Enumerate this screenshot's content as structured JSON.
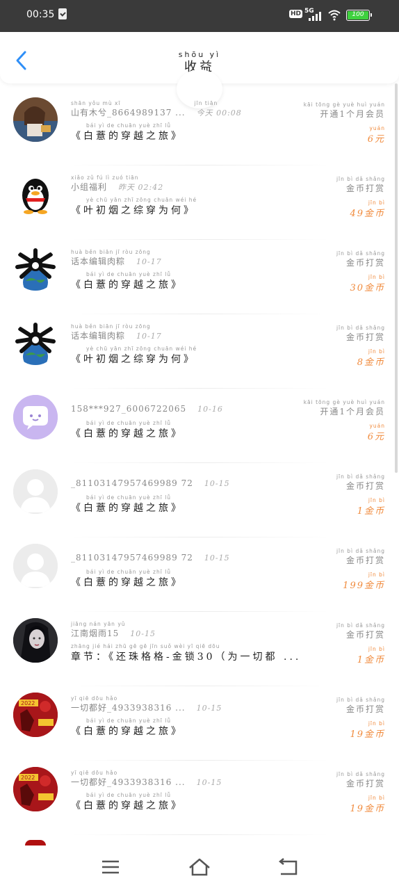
{
  "status_bar": {
    "time": "00:35",
    "hd": "HD",
    "network": "5G",
    "battery": "100",
    "battery_color": "#3fd13f"
  },
  "header": {
    "back_icon": "chevron-left-icon",
    "title_ruby": "shōu yì",
    "title": "收益",
    "accent_color": "#2f8ff7"
  },
  "items": [
    {
      "avatar": "anime-girl",
      "name_ruby": "shān yǒu mù  xī",
      "name": "山有木兮_8664989137 ...",
      "time_ruby": "jīn tiān",
      "time": "今天 00:08",
      "title_ruby": "bái  yì  de chuān yuè zhī  lǚ",
      "title": "《白薏的穿越之旅》",
      "type_ruby": "kāi tōng   gè  yuè huì yuán",
      "type": "开通1个月会员",
      "amount_ruby": "yuán",
      "amount": "6元"
    },
    {
      "avatar": "penguin",
      "name_ruby": "xiǎo zǔ  fú  lì     zuó tiān",
      "name": "小组福利",
      "time_ruby": "",
      "time": "昨天 02:42",
      "title_ruby": "yè  chū yān zhī zōng chuān wéi  hé",
      "title": "《叶初烟之综穿为何》",
      "type_ruby": "jīn  bì  dǎ shǎng",
      "type": "金币打赏",
      "amount_ruby": "jīn  bì",
      "amount": "49金币"
    },
    {
      "avatar": "skull-globe",
      "name_ruby": "huà běn biān  jī  ròu zōng",
      "name": "话本编辑肉粽",
      "time_ruby": "",
      "time": "10-17",
      "title_ruby": "bái  yì  de chuān yuè zhī  lǚ",
      "title": "《白薏的穿越之旅》",
      "type_ruby": "jīn  bì  dǎ shǎng",
      "type": "金币打赏",
      "amount_ruby": "jīn  bì",
      "amount": "30金币"
    },
    {
      "avatar": "skull-globe",
      "name_ruby": "huà běn biān  jī  ròu zōng",
      "name": "话本编辑肉粽",
      "time_ruby": "",
      "time": "10-17",
      "title_ruby": "yè  chū yān zhī zōng chuān wéi  hé",
      "title": "《叶初烟之综穿为何》",
      "type_ruby": "jīn  bì  dǎ shǎng",
      "type": "金币打赏",
      "amount_ruby": "jīn  bì",
      "amount": "8金币"
    },
    {
      "avatar": "chat-bubble",
      "name_ruby": "",
      "name": "158***927_6006722065",
      "time_ruby": "",
      "time": "10-16",
      "title_ruby": "bái  yì  de chuān yuè zhī  lǚ",
      "title": "《白薏的穿越之旅》",
      "type_ruby": "kāi tōng   gè  yuè huì yuán",
      "type": "开通1个月会员",
      "amount_ruby": "yuán",
      "amount": "6元"
    },
    {
      "avatar": "default-user",
      "name_ruby": "",
      "name": "_81103147957469989 72",
      "time_ruby": "",
      "time": "10-15",
      "title_ruby": "bái  yì  de chuān yuè zhī  lǚ",
      "title": "《白薏的穿越之旅》",
      "type_ruby": "jīn  bì  dǎ shǎng",
      "type": "金币打赏",
      "amount_ruby": "jīn  bì",
      "amount": "1金币"
    },
    {
      "avatar": "default-user",
      "name_ruby": "",
      "name": "_81103147957469989 72",
      "time_ruby": "",
      "time": "10-15",
      "title_ruby": "bái  yì  de chuān yuè zhī  lǚ",
      "title": "《白薏的穿越之旅》",
      "type_ruby": "jīn  bì  dǎ shǎng",
      "type": "金币打赏",
      "amount_ruby": "jīn  bì",
      "amount": "199金币"
    },
    {
      "avatar": "dark-girl",
      "name_ruby": "jiāng nán yān  yǔ",
      "name": "江南烟雨15",
      "time_ruby": "",
      "time": "10-15",
      "title_ruby": "zhāng jié      hái zhū  gē   gē     jīn suǒ       wèi  yī  qiē dōu",
      "title": "章节：《还珠格格-金锁30（为一切都 ...",
      "type_ruby": "jīn  bì  dǎ shǎng",
      "type": "金币打赏",
      "amount_ruby": "jīn  bì",
      "amount": "1金币"
    },
    {
      "avatar": "red-poster",
      "name_ruby": "yī  qiē dōu hǎo",
      "name": "一切都好_4933938316 ...",
      "time_ruby": "",
      "time": "10-15",
      "title_ruby": "bái  yì  de chuān yuè zhī  lǚ",
      "title": "《白薏的穿越之旅》",
      "type_ruby": "jīn  bì  dǎ shǎng",
      "type": "金币打赏",
      "amount_ruby": "jīn  bì",
      "amount": "19金币"
    },
    {
      "avatar": "red-poster",
      "name_ruby": "yī  qiē dōu hǎo",
      "name": "一切都好_4933938316 ...",
      "time_ruby": "",
      "time": "10-15",
      "title_ruby": "bái  yì  de chuān yuè zhī  lǚ",
      "title": "《白薏的穿越之旅》",
      "type_ruby": "jīn  bì  dǎ shǎng",
      "type": "金币打赏",
      "amount_ruby": "jīn  bì",
      "amount": "19金币"
    }
  ],
  "nav_bar": {
    "menu_icon": "menu-icon",
    "home_icon": "home-icon",
    "back_icon": "back-icon"
  },
  "colors": {
    "amount": "#f08a3c",
    "text_secondary": "#888888",
    "text_primary": "#222222"
  }
}
